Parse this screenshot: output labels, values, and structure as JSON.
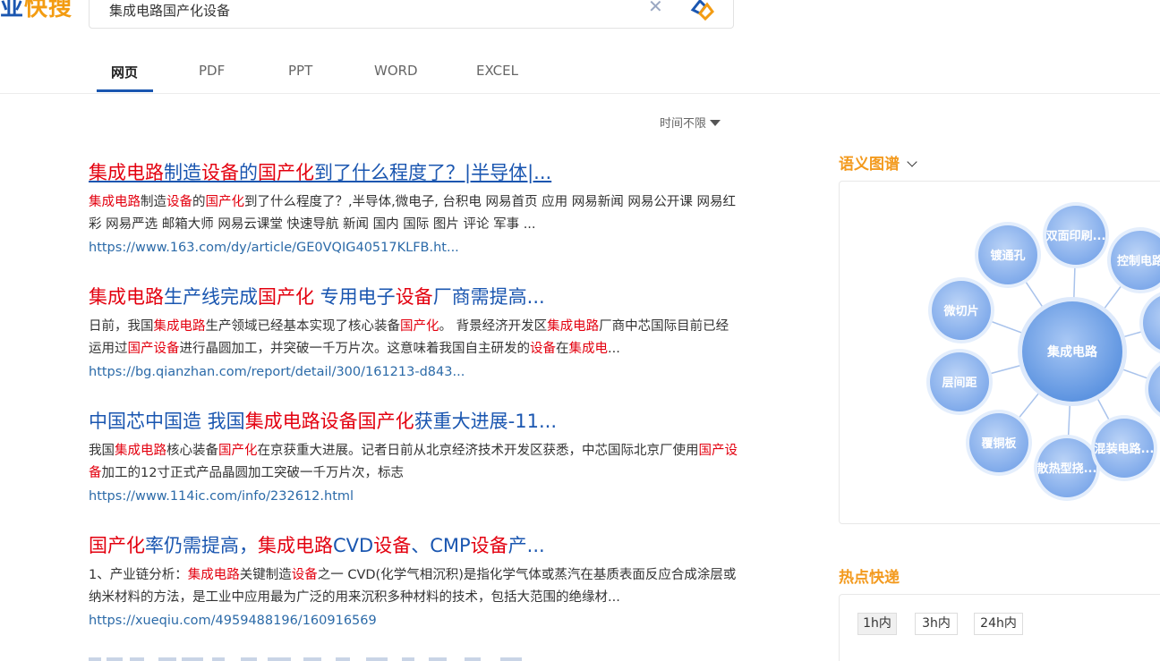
{
  "logo": {
    "part1": "业",
    "part2": "快搜"
  },
  "search": {
    "value": "集成电路国产化设备",
    "clear_icon": "close-icon",
    "button_icon": "search-logo-icon"
  },
  "tabs": [
    {
      "label": "网页",
      "active": true
    },
    {
      "label": "PDF"
    },
    {
      "label": "PPT"
    },
    {
      "label": "WORD"
    },
    {
      "label": "EXCEL"
    }
  ],
  "time_filter": {
    "label": "时间不限"
  },
  "results": [
    {
      "title": [
        {
          "t": "集成电路",
          "hl": true
        },
        {
          "t": "制造"
        },
        {
          "t": "设备",
          "hl": true
        },
        {
          "t": "的"
        },
        {
          "t": "国产化",
          "hl": true
        },
        {
          "t": "到了什么程度了？|半导体|..."
        }
      ],
      "snippet": [
        {
          "t": "集成电路",
          "hl": true
        },
        {
          "t": "制造"
        },
        {
          "t": "设备",
          "hl": true
        },
        {
          "t": "的"
        },
        {
          "t": "国产化",
          "hl": true
        },
        {
          "t": "到了什么程度了？,半导体,微电子, 台积电 网易首页 应用 网易新闻 网易公开课 网易红彩 网易严选 邮箱大师 网易云课堂 快速导航 新闻 国内 国际 图片 评论 军事 ..."
        }
      ],
      "url": "https://www.163.com/dy/article/GE0VQIG40517KLFB.ht..."
    },
    {
      "title": [
        {
          "t": "集成电路",
          "hl": true
        },
        {
          "t": "生产线完成"
        },
        {
          "t": "国产化",
          "hl": true
        },
        {
          "t": " 专用电子"
        },
        {
          "t": "设备",
          "hl": true
        },
        {
          "t": "厂商需提高..."
        }
      ],
      "snippet": [
        {
          "t": "日前，我国"
        },
        {
          "t": "集成电路",
          "hl": true
        },
        {
          "t": "生产领域已经基本实现了核心装备"
        },
        {
          "t": "国产化",
          "hl": true
        },
        {
          "t": "。 背景经济开发区"
        },
        {
          "t": "集成电路",
          "hl": true
        },
        {
          "t": "厂商中芯国际目前已经运用过"
        },
        {
          "t": "国产设备",
          "hl": true
        },
        {
          "t": "进行晶圆加工，并突破一千万片次。这意味着我国自主研发的"
        },
        {
          "t": "设备",
          "hl": true
        },
        {
          "t": "在"
        },
        {
          "t": "集成电",
          "hl": true
        },
        {
          "t": "..."
        }
      ],
      "url": "https://bg.qianzhan.com/report/detail/300/161213-d843..."
    },
    {
      "title": [
        {
          "t": "中国芯中国造 我国"
        },
        {
          "t": "集成电路设备国产化",
          "hl": true
        },
        {
          "t": "获重大进展-11..."
        }
      ],
      "snippet": [
        {
          "t": "我国"
        },
        {
          "t": "集成电路",
          "hl": true
        },
        {
          "t": "核心装备"
        },
        {
          "t": "国产化",
          "hl": true
        },
        {
          "t": "在京获重大进展。记者日前从北京经济技术开发区获悉，中芯国际北京厂使用"
        },
        {
          "t": "国产设备",
          "hl": true
        },
        {
          "t": "加工的12寸正式产品晶圆加工突破一千万片次，标志"
        }
      ],
      "url": "https://www.114ic.com/info/232612.html"
    },
    {
      "title": [
        {
          "t": "国产化",
          "hl": true
        },
        {
          "t": "率仍需提高，"
        },
        {
          "t": "集成电路",
          "hl": true
        },
        {
          "t": "CVD"
        },
        {
          "t": "设备",
          "hl": true
        },
        {
          "t": "、CMP"
        },
        {
          "t": "设备",
          "hl": true
        },
        {
          "t": "产..."
        }
      ],
      "snippet": [
        {
          "t": "1、产业链分析："
        },
        {
          "t": "集成电路",
          "hl": true
        },
        {
          "t": "关键制造"
        },
        {
          "t": "设备",
          "hl": true
        },
        {
          "t": "之一 CVD(化学气相沉积)是指化学气体或蒸汽在基质表面反应合成涂层或纳米材料的方法，是工业中应用最为广泛的用来沉积多种材料的技术，包括大范围的绝缘材..."
        }
      ],
      "url": "https://xueqiu.com/4959488196/160916569"
    }
  ],
  "semantic_graph": {
    "title": "语义图谱",
    "center": "集成电路",
    "nodes": [
      "镀通孔",
      "双面印刷...",
      "控制电路",
      "微切片",
      "层间距",
      "覆铜板",
      "散热型挠...",
      "混装电路...",
      "",
      "",
      ""
    ]
  },
  "hot": {
    "title": "热点快递",
    "buttons": [
      {
        "label": "1h内",
        "active": true
      },
      {
        "label": "3h内"
      },
      {
        "label": "24h内"
      }
    ]
  },
  "colors": {
    "brand": "#1a56b0",
    "highlight": "#e3000f",
    "accent": "#f39a1e",
    "url": "#2b6aa8"
  }
}
